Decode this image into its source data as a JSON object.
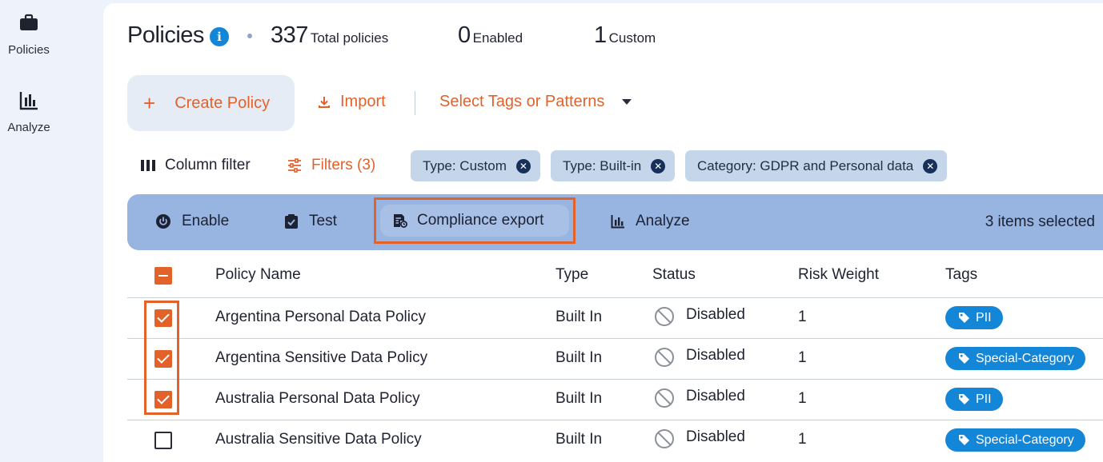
{
  "sidebar": {
    "items": [
      {
        "label": "Policies",
        "icon": "briefcase-icon"
      },
      {
        "label": "Analyze",
        "icon": "bar-chart-icon"
      }
    ]
  },
  "header": {
    "title": "Policies",
    "stats": [
      {
        "value": "337",
        "caption": "Total policies"
      },
      {
        "value": "0",
        "caption": "Enabled"
      },
      {
        "value": "1",
        "caption": "Custom"
      }
    ]
  },
  "actions": {
    "create_label": "Create Policy",
    "import_label": "Import",
    "tag_select_placeholder": "Select Tags or Patterns"
  },
  "filterbar": {
    "column_filter_label": "Column filter",
    "filters_label": "Filters (3)",
    "chips": [
      "Type: Custom",
      "Type: Built-in",
      "Category: GDPR and Personal data"
    ]
  },
  "bulk": {
    "enable_label": "Enable",
    "test_label": "Test",
    "export_label": "Compliance export",
    "analyze_label": "Analyze",
    "selected_text": "3 items selected"
  },
  "table": {
    "columns": [
      "Policy Name",
      "Type",
      "Status",
      "Risk Weight",
      "Tags"
    ],
    "rows": [
      {
        "name": "Argentina Personal Data Policy",
        "type": "Built In",
        "status": "Disabled",
        "risk": "1",
        "tag": "PII",
        "checked": true
      },
      {
        "name": "Argentina Sensitive Data Policy",
        "type": "Built In",
        "status": "Disabled",
        "risk": "1",
        "tag": "Special-Category",
        "checked": true
      },
      {
        "name": "Australia Personal Data Policy",
        "type": "Built In",
        "status": "Disabled",
        "risk": "1",
        "tag": "PII",
        "checked": true
      },
      {
        "name": "Australia Sensitive Data Policy",
        "type": "Built In",
        "status": "Disabled",
        "risk": "1",
        "tag": "Special-Category",
        "checked": false
      }
    ]
  },
  "colors": {
    "accent": "#e2622a",
    "info_blue": "#1486d8",
    "bulk_bar": "#98b4e0",
    "chip_bg": "#c6d6ea"
  }
}
